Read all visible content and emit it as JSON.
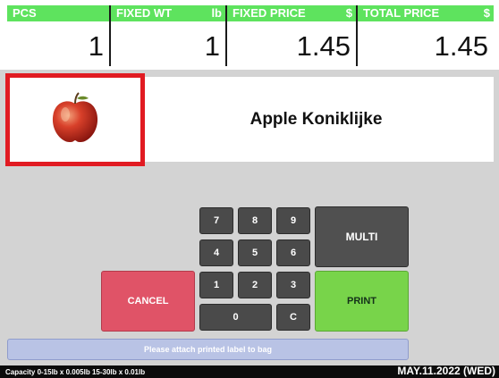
{
  "header": {
    "cells": [
      {
        "label": "PCS",
        "unit": "",
        "value": "1"
      },
      {
        "label": "FIXED WT",
        "unit": "lb",
        "value": "1"
      },
      {
        "label": "FIXED PRICE",
        "unit": "$",
        "value": "1.45"
      },
      {
        "label": "TOTAL PRICE",
        "unit": "$",
        "value": "1.45"
      }
    ]
  },
  "product": {
    "name": "Apple Koniklijke",
    "image_icon": "apple-icon"
  },
  "keypad": {
    "keys": [
      "7",
      "8",
      "9",
      "4",
      "5",
      "6",
      "1",
      "2",
      "3",
      "0",
      "C"
    ]
  },
  "buttons": {
    "multi": "MULTI",
    "cancel": "CANCEL",
    "print": "PRINT"
  },
  "message": "Please attach printed label to bag",
  "status": {
    "capacity": "Capacity 0-15lb x 0.005lb  15-30lb x 0.01lb",
    "date": "MAY.11.2022 (WED)"
  },
  "colors": {
    "header_label_bg": "#5ee35e",
    "highlight": "#e11b22",
    "cancel": "#e05367",
    "print": "#78d44a",
    "key": "#4a4a4a"
  }
}
